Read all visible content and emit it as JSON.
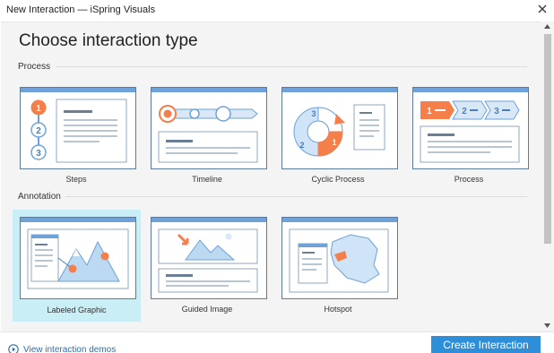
{
  "window": {
    "title": "New Interaction — iSpring Visuals"
  },
  "main": {
    "heading": "Choose interaction type",
    "sections": [
      {
        "label": "Process",
        "cards": [
          {
            "label": "Steps",
            "thumbnail": "steps-thumbnail",
            "selected": false
          },
          {
            "label": "Timeline",
            "thumbnail": "timeline-thumbnail",
            "selected": false
          },
          {
            "label": "Cyclic Process",
            "thumbnail": "cyclic-process-thumbnail",
            "selected": false
          },
          {
            "label": "Process",
            "thumbnail": "process-thumbnail",
            "selected": false
          }
        ]
      },
      {
        "label": "Annotation",
        "cards": [
          {
            "label": "Labeled Graphic",
            "thumbnail": "labeled-graphic-thumbnail",
            "selected": true
          },
          {
            "label": "Guided Image",
            "thumbnail": "guided-image-thumbnail",
            "selected": false
          },
          {
            "label": "Hotspot",
            "thumbnail": "hotspot-thumbnail",
            "selected": false
          }
        ]
      }
    ]
  },
  "thumbnails": {
    "steps": {
      "numbers": [
        "1",
        "2",
        "3"
      ]
    },
    "cyclic": {
      "numbers": [
        "3",
        "2",
        "1"
      ]
    },
    "process": {
      "numbers": [
        "1",
        "2",
        "3"
      ]
    }
  },
  "footer": {
    "demo_link": "View interaction demos",
    "create_button": "Create Interaction"
  },
  "colors": {
    "accent_blue": "#2d8fd9",
    "thumb_header_blue": "#6ea2d8",
    "highlight_orange": "#f47f4a",
    "selected_card_bg": "#c9eef5",
    "light_blue_fill": "#cfe4f7"
  },
  "icons": {
    "close": "close-icon",
    "play": "play-circle-icon"
  }
}
